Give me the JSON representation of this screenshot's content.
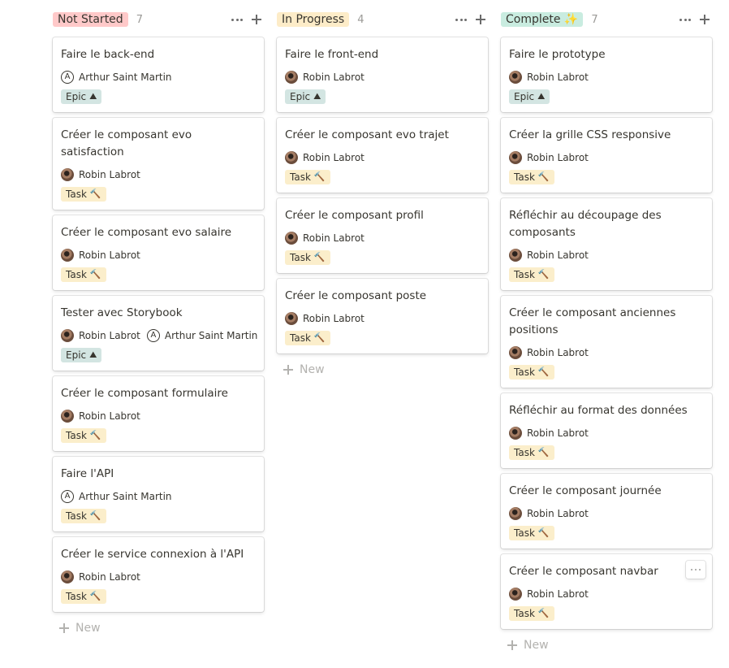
{
  "columns": [
    {
      "name": "Not Started",
      "count": "7",
      "color": "#ffc9c9",
      "cards": [
        {
          "title": "Faire le back-end",
          "people": [
            "Arthur Saint Martin"
          ],
          "tag": "Epic"
        },
        {
          "title": "Créer le composant evo satisfaction",
          "people": [
            "Robin Labrot"
          ],
          "tag": "Task"
        },
        {
          "title": "Créer le composant evo salaire",
          "people": [
            "Robin Labrot"
          ],
          "tag": "Task"
        },
        {
          "title": "Tester avec Storybook",
          "people": [
            "Robin Labrot",
            "Arthur Saint Martin"
          ],
          "tag": "Epic"
        },
        {
          "title": "Créer le composant formulaire",
          "people": [
            "Robin Labrot"
          ],
          "tag": "Task"
        },
        {
          "title": "Faire l'API",
          "people": [
            "Arthur Saint Martin"
          ],
          "tag": "Task"
        },
        {
          "title": "Créer le service connexion à l'API",
          "people": [
            "Robin Labrot"
          ],
          "tag": "Task"
        }
      ],
      "new_label": "New"
    },
    {
      "name": "In Progress",
      "count": "4",
      "color": "#fdecc8",
      "cards": [
        {
          "title": "Faire le front-end",
          "people": [
            "Robin Labrot"
          ],
          "tag": "Epic"
        },
        {
          "title": "Créer le composant evo trajet",
          "people": [
            "Robin Labrot"
          ],
          "tag": "Task"
        },
        {
          "title": "Créer le composant profil",
          "people": [
            "Robin Labrot"
          ],
          "tag": "Task"
        },
        {
          "title": "Créer le composant poste",
          "people": [
            "Robin Labrot"
          ],
          "tag": "Task"
        }
      ],
      "new_label": "New"
    },
    {
      "name": "Complete",
      "name_emoji": "✨",
      "count": "7",
      "color": "#c9ece0",
      "cards": [
        {
          "title": "Faire le prototype",
          "people": [
            "Robin Labrot"
          ],
          "tag": "Epic"
        },
        {
          "title": "Créer la grille CSS responsive",
          "people": [
            "Robin Labrot"
          ],
          "tag": "Task"
        },
        {
          "title": "Réfléchir au découpage des composants",
          "people": [
            "Robin Labrot"
          ],
          "tag": "Task"
        },
        {
          "title": "Créer le composant anciennes positions",
          "people": [
            "Robin Labrot"
          ],
          "tag": "Task"
        },
        {
          "title": "Réfléchir au format des données",
          "people": [
            "Robin Labrot"
          ],
          "tag": "Task"
        },
        {
          "title": "Créer le composant journée",
          "people": [
            "Robin Labrot"
          ],
          "tag": "Task"
        },
        {
          "title": "Créer le composant navbar",
          "people": [
            "Robin Labrot"
          ],
          "tag": "Task",
          "hover_menu": true
        }
      ],
      "new_label": "New"
    }
  ],
  "tags": {
    "Epic": {
      "icon": "⛰",
      "color": "#d3e5e2"
    },
    "Task": {
      "icon": "🔨",
      "color": "#fbeecb"
    }
  },
  "avatars": {
    "Robin Labrot": "photo",
    "Arthur Saint Martin": "letter-a",
    "Arthur Saint Martin_letter": "A"
  }
}
